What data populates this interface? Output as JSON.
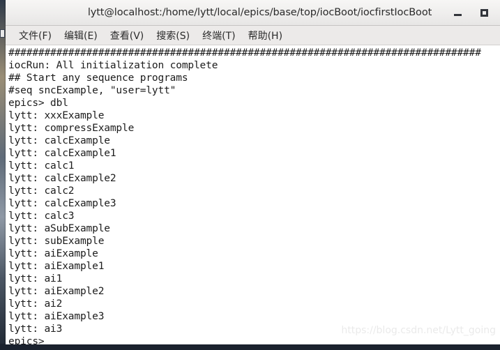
{
  "window": {
    "title": "lytt@localhost:/home/lytt/local/epics/base/top/iocBoot/iocfirstIocBoot",
    "controls": [
      {
        "name": "minimize",
        "label": "_"
      },
      {
        "name": "maximize",
        "label": "□"
      }
    ]
  },
  "menubar": {
    "items": [
      {
        "label": "文件(F)"
      },
      {
        "label": "编辑(E)"
      },
      {
        "label": "查看(V)"
      },
      {
        "label": "搜索(S)"
      },
      {
        "label": "终端(T)"
      },
      {
        "label": "帮助(H)"
      }
    ]
  },
  "terminal": {
    "prompt": "epics>",
    "command": "dbl",
    "lines": [
      "###############################################################################",
      "iocRun: All initialization complete",
      "## Start any sequence programs",
      "#seq sncExample, \"user=lytt\"",
      "epics> dbl",
      "lytt: xxxExample",
      "lytt: compressExample",
      "lytt: calcExample",
      "lytt: calcExample1",
      "lytt: calc1",
      "lytt: calcExample2",
      "lytt: calc2",
      "lytt: calcExample3",
      "lytt: calc3",
      "lytt: aSubExample",
      "lytt: subExample",
      "lytt: aiExample",
      "lytt: aiExample1",
      "lytt: ai1",
      "lytt: aiExample2",
      "lytt: ai2",
      "lytt: aiExample3",
      "lytt: ai3",
      "epics>"
    ]
  },
  "watermark": {
    "text": "https://blog.csdn.net/Lytt_going"
  },
  "colors": {
    "terminal_background": "#ffffff",
    "terminal_text": "#1c1c1c",
    "titlebar_background": "#eeedec",
    "menubar_background": "#eceae9",
    "desktop_bottom_bar": "#1b222e"
  }
}
